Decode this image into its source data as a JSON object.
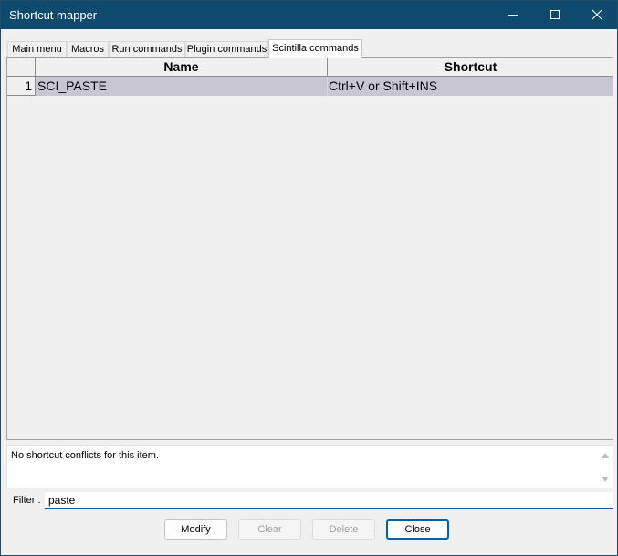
{
  "window": {
    "title": "Shortcut mapper",
    "title_bar_color": "#0d4a6e"
  },
  "tabs": [
    {
      "label": "Main menu",
      "active": false
    },
    {
      "label": "Macros",
      "active": false
    },
    {
      "label": "Run commands",
      "active": false
    },
    {
      "label": "Plugin commands",
      "active": false
    },
    {
      "label": "Scintilla commands",
      "active": true
    }
  ],
  "grid": {
    "columns": [
      "Name",
      "Shortcut"
    ],
    "rows": [
      {
        "num": "1",
        "name": "SCI_PASTE",
        "shortcut": "Ctrl+V or Shift+INS",
        "selected": true
      }
    ],
    "selection_color": "#c7c6d2"
  },
  "conflict": {
    "text": "No shortcut conflicts for this item."
  },
  "filter": {
    "label": "Filter :",
    "value": "paste"
  },
  "buttons": {
    "modify": "Modify",
    "clear": "Clear",
    "delete": "Delete",
    "close": "Close"
  },
  "icons": [
    "minimize-icon",
    "maximize-icon",
    "close-icon",
    "scroll-up-arrow-icon",
    "scroll-down-arrow-icon"
  ]
}
